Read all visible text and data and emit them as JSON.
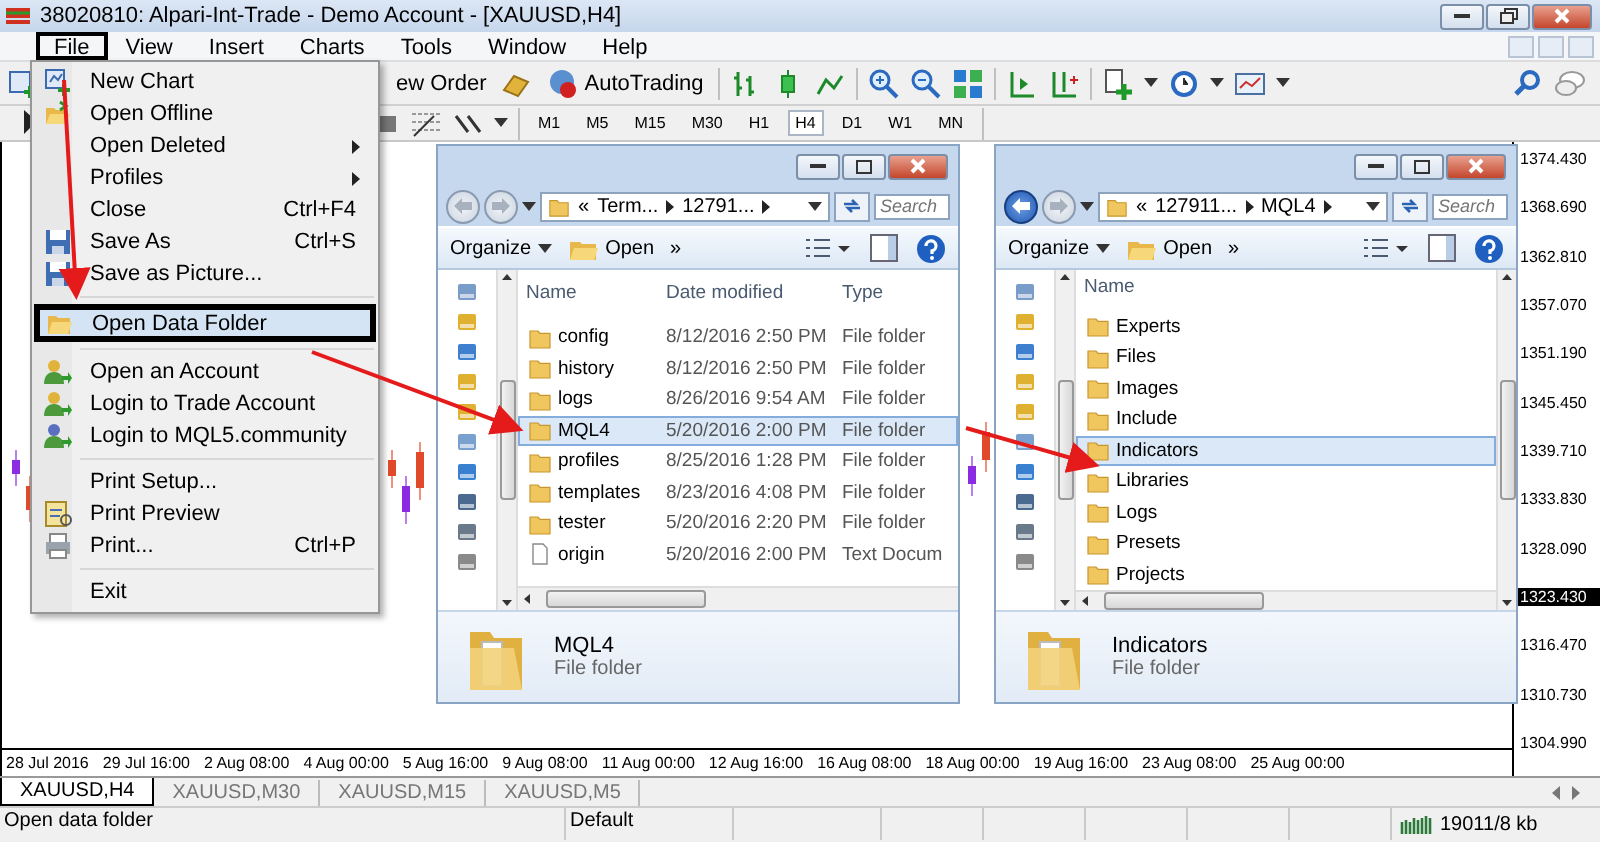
{
  "title_bar": {
    "title": "38020810: Alpari-Int-Trade - Demo Account - [XAUUSD,H4]"
  },
  "menu_bar": [
    {
      "label": "File",
      "selected": true
    },
    {
      "label": "View",
      "selected": false
    },
    {
      "label": "Insert",
      "selected": false
    },
    {
      "label": "Charts",
      "selected": false
    },
    {
      "label": "Tools",
      "selected": false
    },
    {
      "label": "Window",
      "selected": false
    },
    {
      "label": "Help",
      "selected": false
    }
  ],
  "toolbar": {
    "new_order": "ew Order",
    "autotrading": "AutoTrading"
  },
  "timeframes": [
    {
      "label": "M1",
      "selected": false
    },
    {
      "label": "M5",
      "selected": false
    },
    {
      "label": "M15",
      "selected": false
    },
    {
      "label": "M30",
      "selected": false
    },
    {
      "label": "H1",
      "selected": false
    },
    {
      "label": "H4",
      "selected": true
    },
    {
      "label": "D1",
      "selected": false
    },
    {
      "label": "W1",
      "selected": false
    },
    {
      "label": "MN",
      "selected": false
    }
  ],
  "file_menu": [
    {
      "kind": "chart",
      "label": "New Chart",
      "selected": false
    },
    {
      "kind": "open",
      "label": "Open Offline",
      "selected": false
    },
    {
      "kind": "plain",
      "label": "Open Deleted",
      "submenu": true,
      "selected": false
    },
    {
      "kind": "plain",
      "label": "Profiles",
      "submenu": true,
      "selected": false
    },
    {
      "kind": "plain",
      "label": "Close",
      "shortcut": "Ctrl+F4",
      "selected": false
    },
    {
      "kind": "save",
      "label": "Save As",
      "shortcut": "Ctrl+S",
      "selected": false
    },
    {
      "kind": "save",
      "label": "Save as Picture...",
      "selected": false
    },
    {
      "kind": "separator"
    },
    {
      "kind": "folder",
      "label": "Open Data Folder",
      "selected": true
    },
    {
      "kind": "separator"
    },
    {
      "kind": "user",
      "label": "Open an Account",
      "selected": false
    },
    {
      "kind": "user",
      "label": "Login to Trade Account",
      "selected": false
    },
    {
      "kind": "community",
      "label": "Login to MQL5.community",
      "selected": false
    },
    {
      "kind": "separator"
    },
    {
      "kind": "plain",
      "label": "Print Setup...",
      "selected": false
    },
    {
      "kind": "preview",
      "label": "Print Preview",
      "selected": false
    },
    {
      "kind": "print",
      "label": "Print...",
      "shortcut": "Ctrl+P",
      "selected": false
    },
    {
      "kind": "separator"
    },
    {
      "kind": "plain",
      "label": "Exit",
      "selected": false
    }
  ],
  "chart": {
    "prices": [
      {
        "value": "1374.430",
        "current": false
      },
      {
        "value": "1368.690",
        "current": false
      },
      {
        "value": "1362.810",
        "current": false
      },
      {
        "value": "1357.070",
        "current": false
      },
      {
        "value": "1351.190",
        "current": false
      },
      {
        "value": "1345.450",
        "current": false
      },
      {
        "value": "1339.710",
        "current": false
      },
      {
        "value": "1333.830",
        "current": false
      },
      {
        "value": "1328.090",
        "current": false
      },
      {
        "value": "1323.430",
        "current": true
      },
      {
        "value": "1316.470",
        "current": false
      },
      {
        "value": "1310.730",
        "current": false
      },
      {
        "value": "1304.990",
        "current": false
      }
    ],
    "times": [
      "28 Jul 2016",
      "29 Jul 16:00",
      "2 Aug 08:00",
      "4 Aug 00:00",
      "5 Aug 16:00",
      "9 Aug 08:00",
      "11 Aug 00:00",
      "12 Aug 16:00",
      "16 Aug 08:00",
      "18 Aug 00:00",
      "19 Aug 16:00",
      "23 Aug 08:00",
      "25 Aug 00:00"
    ]
  },
  "explorers": [
    {
      "back_enabled": false,
      "prefix": "«",
      "path": [
        "Term...",
        "12791..."
      ],
      "search_placeholder": "Search",
      "organize": "Organize",
      "open": "Open",
      "more": "»",
      "columns": [
        "Name",
        "Date modified",
        "Type"
      ],
      "rows": [
        {
          "kind": "folder",
          "name": "config",
          "date": "8/12/2016 2:50 PM",
          "type": "File folder",
          "selected": false
        },
        {
          "kind": "folder",
          "name": "history",
          "date": "8/12/2016 2:50 PM",
          "type": "File folder",
          "selected": false
        },
        {
          "kind": "folder",
          "name": "logs",
          "date": "8/26/2016 9:54 AM",
          "type": "File folder",
          "selected": false
        },
        {
          "kind": "folder",
          "name": "MQL4",
          "date": "5/20/2016 2:00 PM",
          "type": "File folder",
          "selected": true
        },
        {
          "kind": "folder",
          "name": "profiles",
          "date": "8/25/2016 1:28 PM",
          "type": "File folder",
          "selected": false
        },
        {
          "kind": "folder",
          "name": "templates",
          "date": "8/23/2016 4:08 PM",
          "type": "File folder",
          "selected": false
        },
        {
          "kind": "folder",
          "name": "tester",
          "date": "5/20/2016 2:20 PM",
          "type": "File folder",
          "selected": false
        },
        {
          "kind": "file",
          "name": "origin",
          "date": "5/20/2016 2:00 PM",
          "type": "Text Docum",
          "selected": false
        }
      ],
      "details": {
        "name": "MQL4",
        "type": "File folder"
      }
    },
    {
      "back_enabled": true,
      "prefix": "«",
      "path": [
        "127911...",
        "MQL4"
      ],
      "search_placeholder": "Search",
      "organize": "Organize",
      "open": "Open",
      "more": "»",
      "columns": [
        "Name"
      ],
      "rows": [
        {
          "kind": "folder",
          "name": "Experts",
          "selected": false
        },
        {
          "kind": "folder",
          "name": "Files",
          "selected": false
        },
        {
          "kind": "folder",
          "name": "Images",
          "selected": false
        },
        {
          "kind": "folder",
          "name": "Include",
          "selected": false
        },
        {
          "kind": "folder",
          "name": "Indicators",
          "selected": true
        },
        {
          "kind": "folder",
          "name": "Libraries",
          "selected": false
        },
        {
          "kind": "folder",
          "name": "Logs",
          "selected": false
        },
        {
          "kind": "folder",
          "name": "Presets",
          "selected": false
        },
        {
          "kind": "folder",
          "name": "Projects",
          "selected": false
        }
      ],
      "details": {
        "name": "Indicators",
        "type": "File folder"
      }
    }
  ],
  "tabs": [
    {
      "label": "XAUUSD,H4",
      "selected": true
    },
    {
      "label": "XAUUSD,M30",
      "selected": false
    },
    {
      "label": "XAUUSD,M15",
      "selected": false
    },
    {
      "label": "XAUUSD,M5",
      "selected": false
    }
  ],
  "status_bar": {
    "message": "Open data folder",
    "profile": "Default",
    "traffic": "19011/8 kb"
  }
}
